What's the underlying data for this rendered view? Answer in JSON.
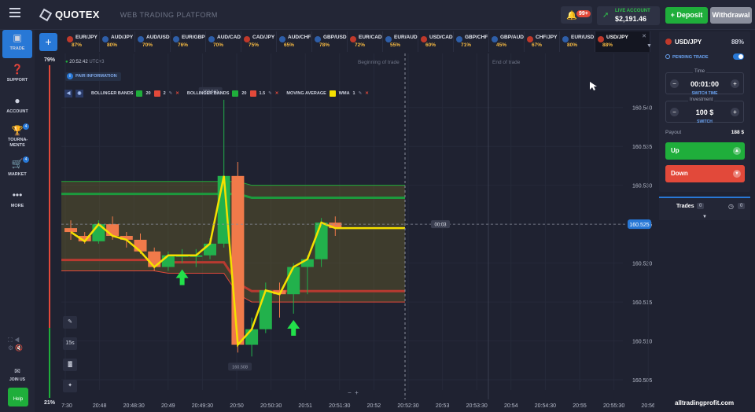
{
  "header": {
    "logo_text": "QUOTEX",
    "subtitle": "WEB TRADING PLATFORM",
    "notifications_badge": "99+",
    "account_label": "LIVE ACCOUNT",
    "balance": "$2,191.46",
    "deposit_label": "Deposit",
    "withdrawal_label": "Withdrawal"
  },
  "sidebar": {
    "items": [
      {
        "label": "TRADE",
        "icon": "chart-icon"
      },
      {
        "label": "SUPPORT",
        "icon": "question-icon"
      },
      {
        "label": "ACCOUNT",
        "icon": "user-icon"
      },
      {
        "label": "TOURNA-MENTS",
        "icon": "trophy-icon",
        "badge": "4"
      },
      {
        "label": "MARKET",
        "icon": "cart-icon",
        "badge": "4"
      },
      {
        "label": "MORE",
        "icon": "dots-icon"
      }
    ],
    "join_label": "JOIN US",
    "help_label": "Help"
  },
  "assets": [
    {
      "symbol": "EUR/JPY",
      "pct": "87%",
      "color": "#c0392b"
    },
    {
      "symbol": "AUD/JPY",
      "pct": "80%",
      "color": "#2e5ea8"
    },
    {
      "symbol": "AUD/USD",
      "pct": "70%",
      "color": "#2e5ea8"
    },
    {
      "symbol": "EUR/GBP",
      "pct": "76%",
      "color": "#2e5ea8"
    },
    {
      "symbol": "AUD/CAD",
      "pct": "70%",
      "color": "#2e5ea8"
    },
    {
      "symbol": "CAD/JPY",
      "pct": "75%",
      "color": "#c0392b"
    },
    {
      "symbol": "AUD/CHF",
      "pct": "65%",
      "color": "#2e5ea8"
    },
    {
      "symbol": "GBP/USD",
      "pct": "78%",
      "color": "#2e5ea8"
    },
    {
      "symbol": "EUR/CAD",
      "pct": "72%",
      "color": "#c0392b"
    },
    {
      "symbol": "EUR/AUD",
      "pct": "55%",
      "color": "#2e5ea8"
    },
    {
      "symbol": "USD/CAD",
      "pct": "60%",
      "color": "#c0392b"
    },
    {
      "symbol": "GBP/CHF",
      "pct": "71%",
      "color": "#2e5ea8"
    },
    {
      "symbol": "GBP/AUD",
      "pct": "45%",
      "color": "#2e5ea8"
    },
    {
      "symbol": "CHF/JPY",
      "pct": "67%",
      "color": "#c0392b"
    },
    {
      "symbol": "EUR/USD",
      "pct": "80%",
      "color": "#2e5ea8"
    },
    {
      "symbol": "USD/JPY",
      "pct": "88%",
      "color": "#c0392b",
      "active": true
    }
  ],
  "chart": {
    "time": "20:52:42",
    "timezone": "UTC+3",
    "pair_info_label": "PAIR INFORMATION",
    "sentiment_top": "79%",
    "sentiment_bottom": "21%",
    "beginning_label": "Beginning of trade",
    "end_label": "End of trade",
    "countdown": "00:03",
    "current_price": "160.525",
    "high_label": "160.541",
    "low_label": "160.508",
    "timeframe": "15s",
    "watermark": "alltradingprofit.com",
    "indicators": [
      {
        "name": "BOLLINGER BANDS",
        "period": "20",
        "dev": "2",
        "colors": [
          "#1fae3b",
          "#e2493a"
        ]
      },
      {
        "name": "BOLLINGER BANDS",
        "period": "20",
        "dev": "1.5",
        "colors": [
          "#1fae3b",
          "#e2493a"
        ]
      },
      {
        "name": "MOVING AVERAGE",
        "type": "WMA",
        "period": "1",
        "colors": [
          "#f5e000"
        ]
      }
    ]
  },
  "chart_data": {
    "type": "candlestick",
    "price_ticks": [
      "160.540",
      "160.535",
      "160.530",
      "160.525",
      "160.520",
      "160.515",
      "160.510",
      "160.505"
    ],
    "time_ticks": [
      "47:30",
      "20:48",
      "20:48:30",
      "20:49",
      "20:49:30",
      "20:50",
      "20:50:30",
      "20:51",
      "20:51:30",
      "20:52",
      "20:52:30",
      "20:53",
      "20:53:30",
      "20:54",
      "20:54:30",
      "20:55",
      "20:55:30",
      "20:56"
    ],
    "candles": [
      {
        "o": 160.5245,
        "c": 160.524,
        "h": 160.5255,
        "l": 160.523
      },
      {
        "o": 160.5235,
        "c": 160.5228,
        "h": 160.524,
        "l": 160.5225
      },
      {
        "o": 160.5228,
        "c": 160.525,
        "h": 160.5255,
        "l": 160.5225
      },
      {
        "o": 160.525,
        "c": 160.5235,
        "h": 160.526,
        "l": 160.523
      },
      {
        "o": 160.5235,
        "c": 160.523,
        "h": 160.524,
        "l": 160.522
      },
      {
        "o": 160.523,
        "c": 160.5215,
        "h": 160.5238,
        "l": 160.5212
      },
      {
        "o": 160.5215,
        "c": 160.5195,
        "h": 160.522,
        "l": 160.519
      },
      {
        "o": 160.5195,
        "c": 160.521,
        "h": 160.5215,
        "l": 160.519
      },
      {
        "o": 160.521,
        "c": 160.521,
        "h": 160.5218,
        "l": 160.52
      },
      {
        "o": 160.521,
        "c": 160.521,
        "h": 160.5218,
        "l": 160.5195
      },
      {
        "o": 160.521,
        "c": 160.5225,
        "h": 160.5232,
        "l": 160.5205
      },
      {
        "o": 160.5225,
        "c": 160.5312,
        "h": 160.541,
        "l": 160.522
      },
      {
        "o": 160.5312,
        "c": 160.5095,
        "h": 160.533,
        "l": 160.5085
      },
      {
        "o": 160.5095,
        "c": 160.5115,
        "h": 160.513,
        "l": 160.508
      },
      {
        "o": 160.5115,
        "c": 160.5165,
        "h": 160.5175,
        "l": 160.511
      },
      {
        "o": 160.5165,
        "c": 160.516,
        "h": 160.5175,
        "l": 160.513
      },
      {
        "o": 160.516,
        "c": 160.5195,
        "h": 160.52,
        "l": 160.5135
      },
      {
        "o": 160.5195,
        "c": 160.5205,
        "h": 160.521,
        "l": 160.516
      },
      {
        "o": 160.5205,
        "c": 160.5252,
        "h": 160.5258,
        "l": 160.5195
      },
      {
        "o": 160.5252,
        "c": 160.5245,
        "h": 160.526,
        "l": 160.5235
      }
    ],
    "arrows": [
      {
        "candle": 8,
        "direction": "up"
      },
      {
        "candle": 16,
        "direction": "up"
      }
    ],
    "ylim": [
      160.5045,
      160.5425
    ]
  },
  "panel": {
    "pair": "USD/JPY",
    "pct": "88%",
    "pending_label": "PENDING TRADE",
    "time_label": "Time",
    "time_value": "00:01:00",
    "switch_time_label": "SWITCH TIME",
    "investment_label": "Investment",
    "investment_value": "100 $",
    "switch_label": "SWITCH",
    "payout_label": "Payout",
    "payout_value": "188 $",
    "up_label": "Up",
    "down_label": "Down",
    "trades_label": "Trades",
    "trades_count": "0",
    "pending_count": "0"
  }
}
